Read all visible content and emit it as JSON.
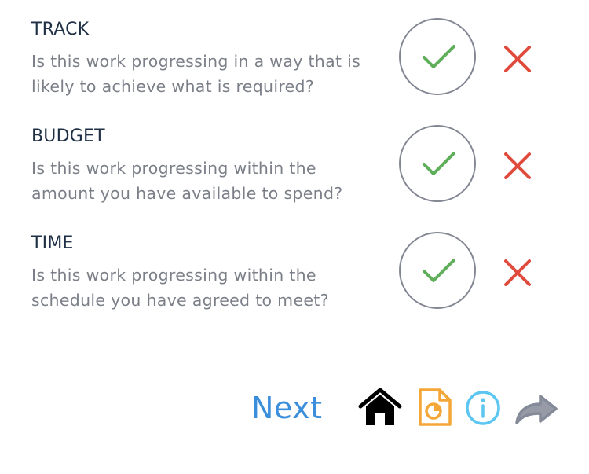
{
  "items": [
    {
      "title": "TRACK",
      "question": "Is this work progressing in a way that is likely to achieve what is required?",
      "yes_icon": "check-icon",
      "no_icon": "cross-icon"
    },
    {
      "title": "BUDGET",
      "question": "Is this work progressing within the amount you have available to spend?",
      "yes_icon": "check-icon",
      "no_icon": "cross-icon"
    },
    {
      "title": "TIME",
      "question": "Is this work progressing within the schedule you have agreed to meet?",
      "yes_icon": "check-icon",
      "no_icon": "cross-icon"
    }
  ],
  "footer": {
    "next_label": "Next",
    "icons": [
      "home-icon",
      "report-icon",
      "info-icon",
      "share-icon"
    ]
  },
  "colors": {
    "title": "#1f3046",
    "question": "#7b7f88",
    "check": "#5fae5a",
    "cross": "#e04a3c",
    "circle_border": "#838794",
    "next": "#3a8edb",
    "home": "#000000",
    "report": "#f4a637",
    "info": "#5cc6f0",
    "share": "#858a98"
  }
}
